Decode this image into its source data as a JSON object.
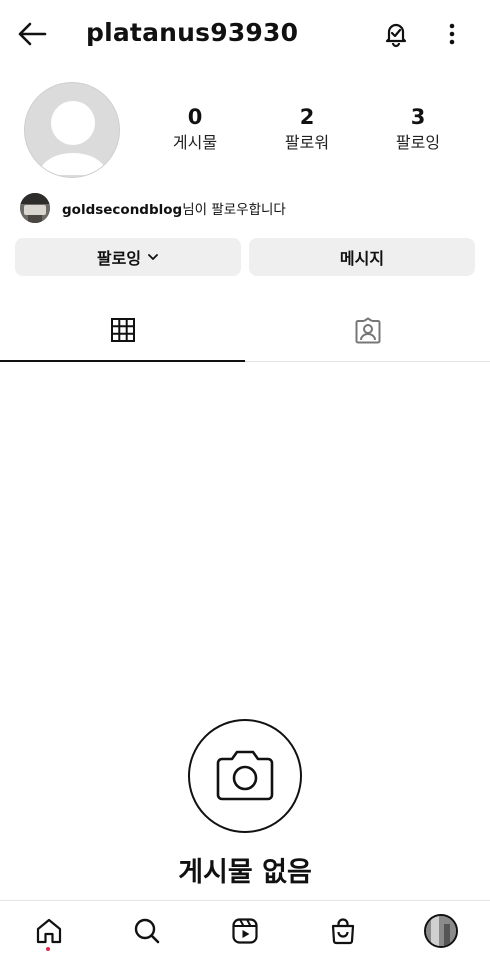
{
  "header": {
    "username": "platanus93930",
    "back_icon": "arrow-left-icon",
    "bell_icon": "bell-check-icon",
    "more_icon": "more-vertical-icon"
  },
  "profile": {
    "avatar_icon": "default-avatar-icon",
    "stats": [
      {
        "value": "0",
        "label": "게시물"
      },
      {
        "value": "2",
        "label": "팔로워"
      },
      {
        "value": "3",
        "label": "팔로잉"
      }
    ],
    "followed_by": {
      "username": "goldsecondblog",
      "suffix": "님이 팔로우합니다"
    }
  },
  "actions": {
    "follow_label": "팔로잉",
    "message_label": "메시지"
  },
  "tabs": [
    {
      "icon": "grid-icon",
      "active": true
    },
    {
      "icon": "tagged-user-icon",
      "active": false
    }
  ],
  "empty_state": {
    "icon": "camera-icon",
    "title": "게시물 없음"
  },
  "bottom_nav": [
    {
      "icon": "home-icon",
      "has_dot": true
    },
    {
      "icon": "search-icon"
    },
    {
      "icon": "reels-icon"
    },
    {
      "icon": "shop-icon"
    },
    {
      "icon": "profile-avatar-icon"
    }
  ],
  "colors": {
    "button_bg": "#efefef",
    "notification_dot": "#e02848",
    "avatar_bg": "#dbdbdb"
  }
}
